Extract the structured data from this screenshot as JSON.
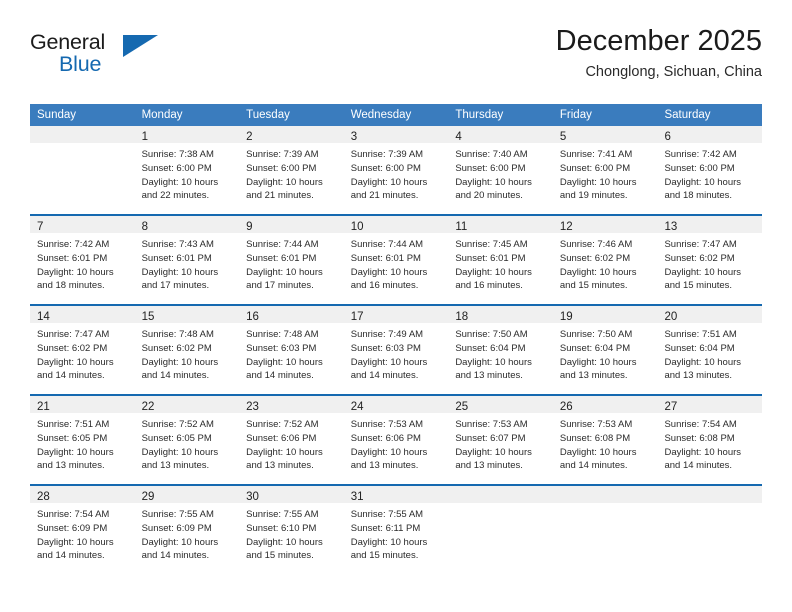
{
  "brand": {
    "word_top": "General",
    "word_bottom": "Blue",
    "accent_color": "#1569b0"
  },
  "header": {
    "title": "December 2025",
    "subtitle": "Chonglong, Sichuan, China"
  },
  "calendar": {
    "header_bg": "#3a7cbe",
    "row_border_color": "#1569b0",
    "daynum_band_bg": "#f0f0f0",
    "day_headers": [
      "Sunday",
      "Monday",
      "Tuesday",
      "Wednesday",
      "Thursday",
      "Friday",
      "Saturday"
    ],
    "weeks": [
      [
        {
          "day": "",
          "lines": []
        },
        {
          "day": "1",
          "lines": [
            "Sunrise: 7:38 AM",
            "Sunset: 6:00 PM",
            "Daylight: 10 hours",
            "and 22 minutes."
          ]
        },
        {
          "day": "2",
          "lines": [
            "Sunrise: 7:39 AM",
            "Sunset: 6:00 PM",
            "Daylight: 10 hours",
            "and 21 minutes."
          ]
        },
        {
          "day": "3",
          "lines": [
            "Sunrise: 7:39 AM",
            "Sunset: 6:00 PM",
            "Daylight: 10 hours",
            "and 21 minutes."
          ]
        },
        {
          "day": "4",
          "lines": [
            "Sunrise: 7:40 AM",
            "Sunset: 6:00 PM",
            "Daylight: 10 hours",
            "and 20 minutes."
          ]
        },
        {
          "day": "5",
          "lines": [
            "Sunrise: 7:41 AM",
            "Sunset: 6:00 PM",
            "Daylight: 10 hours",
            "and 19 minutes."
          ]
        },
        {
          "day": "6",
          "lines": [
            "Sunrise: 7:42 AM",
            "Sunset: 6:00 PM",
            "Daylight: 10 hours",
            "and 18 minutes."
          ]
        }
      ],
      [
        {
          "day": "7",
          "lines": [
            "Sunrise: 7:42 AM",
            "Sunset: 6:01 PM",
            "Daylight: 10 hours",
            "and 18 minutes."
          ]
        },
        {
          "day": "8",
          "lines": [
            "Sunrise: 7:43 AM",
            "Sunset: 6:01 PM",
            "Daylight: 10 hours",
            "and 17 minutes."
          ]
        },
        {
          "day": "9",
          "lines": [
            "Sunrise: 7:44 AM",
            "Sunset: 6:01 PM",
            "Daylight: 10 hours",
            "and 17 minutes."
          ]
        },
        {
          "day": "10",
          "lines": [
            "Sunrise: 7:44 AM",
            "Sunset: 6:01 PM",
            "Daylight: 10 hours",
            "and 16 minutes."
          ]
        },
        {
          "day": "11",
          "lines": [
            "Sunrise: 7:45 AM",
            "Sunset: 6:01 PM",
            "Daylight: 10 hours",
            "and 16 minutes."
          ]
        },
        {
          "day": "12",
          "lines": [
            "Sunrise: 7:46 AM",
            "Sunset: 6:02 PM",
            "Daylight: 10 hours",
            "and 15 minutes."
          ]
        },
        {
          "day": "13",
          "lines": [
            "Sunrise: 7:47 AM",
            "Sunset: 6:02 PM",
            "Daylight: 10 hours",
            "and 15 minutes."
          ]
        }
      ],
      [
        {
          "day": "14",
          "lines": [
            "Sunrise: 7:47 AM",
            "Sunset: 6:02 PM",
            "Daylight: 10 hours",
            "and 14 minutes."
          ]
        },
        {
          "day": "15",
          "lines": [
            "Sunrise: 7:48 AM",
            "Sunset: 6:02 PM",
            "Daylight: 10 hours",
            "and 14 minutes."
          ]
        },
        {
          "day": "16",
          "lines": [
            "Sunrise: 7:48 AM",
            "Sunset: 6:03 PM",
            "Daylight: 10 hours",
            "and 14 minutes."
          ]
        },
        {
          "day": "17",
          "lines": [
            "Sunrise: 7:49 AM",
            "Sunset: 6:03 PM",
            "Daylight: 10 hours",
            "and 14 minutes."
          ]
        },
        {
          "day": "18",
          "lines": [
            "Sunrise: 7:50 AM",
            "Sunset: 6:04 PM",
            "Daylight: 10 hours",
            "and 13 minutes."
          ]
        },
        {
          "day": "19",
          "lines": [
            "Sunrise: 7:50 AM",
            "Sunset: 6:04 PM",
            "Daylight: 10 hours",
            "and 13 minutes."
          ]
        },
        {
          "day": "20",
          "lines": [
            "Sunrise: 7:51 AM",
            "Sunset: 6:04 PM",
            "Daylight: 10 hours",
            "and 13 minutes."
          ]
        }
      ],
      [
        {
          "day": "21",
          "lines": [
            "Sunrise: 7:51 AM",
            "Sunset: 6:05 PM",
            "Daylight: 10 hours",
            "and 13 minutes."
          ]
        },
        {
          "day": "22",
          "lines": [
            "Sunrise: 7:52 AM",
            "Sunset: 6:05 PM",
            "Daylight: 10 hours",
            "and 13 minutes."
          ]
        },
        {
          "day": "23",
          "lines": [
            "Sunrise: 7:52 AM",
            "Sunset: 6:06 PM",
            "Daylight: 10 hours",
            "and 13 minutes."
          ]
        },
        {
          "day": "24",
          "lines": [
            "Sunrise: 7:53 AM",
            "Sunset: 6:06 PM",
            "Daylight: 10 hours",
            "and 13 minutes."
          ]
        },
        {
          "day": "25",
          "lines": [
            "Sunrise: 7:53 AM",
            "Sunset: 6:07 PM",
            "Daylight: 10 hours",
            "and 13 minutes."
          ]
        },
        {
          "day": "26",
          "lines": [
            "Sunrise: 7:53 AM",
            "Sunset: 6:08 PM",
            "Daylight: 10 hours",
            "and 14 minutes."
          ]
        },
        {
          "day": "27",
          "lines": [
            "Sunrise: 7:54 AM",
            "Sunset: 6:08 PM",
            "Daylight: 10 hours",
            "and 14 minutes."
          ]
        }
      ],
      [
        {
          "day": "28",
          "lines": [
            "Sunrise: 7:54 AM",
            "Sunset: 6:09 PM",
            "Daylight: 10 hours",
            "and 14 minutes."
          ]
        },
        {
          "day": "29",
          "lines": [
            "Sunrise: 7:55 AM",
            "Sunset: 6:09 PM",
            "Daylight: 10 hours",
            "and 14 minutes."
          ]
        },
        {
          "day": "30",
          "lines": [
            "Sunrise: 7:55 AM",
            "Sunset: 6:10 PM",
            "Daylight: 10 hours",
            "and 15 minutes."
          ]
        },
        {
          "day": "31",
          "lines": [
            "Sunrise: 7:55 AM",
            "Sunset: 6:11 PM",
            "Daylight: 10 hours",
            "and 15 minutes."
          ]
        },
        {
          "day": "",
          "lines": []
        },
        {
          "day": "",
          "lines": []
        },
        {
          "day": "",
          "lines": []
        }
      ]
    ]
  }
}
